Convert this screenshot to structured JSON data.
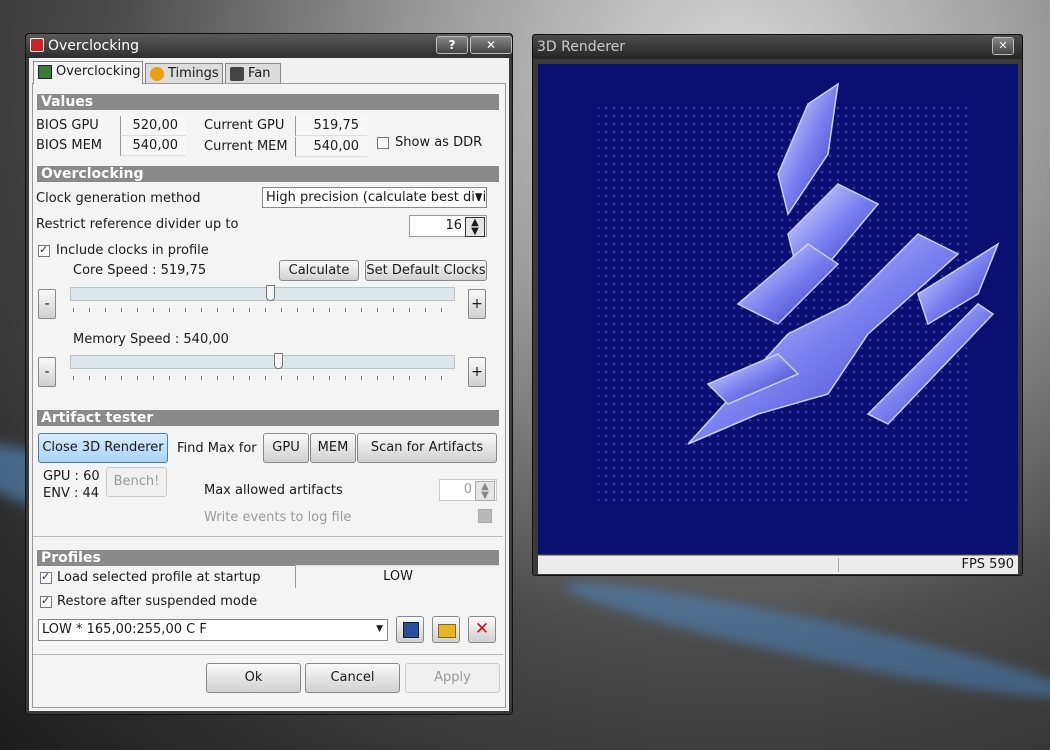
{
  "overclocking_window": {
    "title": "Overclocking",
    "help_label": "?",
    "close_label": "✕",
    "tabs": [
      {
        "label": "Overclocking",
        "icon": "chip-icon"
      },
      {
        "label": "Timings",
        "icon": "timer-icon"
      },
      {
        "label": "Fan",
        "icon": "fan-icon"
      }
    ],
    "values": {
      "header": "Values",
      "bios_gpu_label": "BIOS GPU",
      "bios_gpu_value": "520,00",
      "bios_mem_label": "BIOS MEM",
      "bios_mem_value": "540,00",
      "current_gpu_label": "Current GPU",
      "current_gpu_value": "519,75",
      "current_mem_label": "Current MEM",
      "current_mem_value": "540,00",
      "show_ddr_label": "Show as DDR",
      "show_ddr_checked": false
    },
    "overclocking": {
      "header": "Overclocking",
      "clock_method_label": "Clock generation method",
      "clock_method_value": "High precision (calculate best divi",
      "restrict_label": "Restrict reference divider up to",
      "restrict_value": "16",
      "include_clocks_label": "Include clocks in profile",
      "include_clocks_checked": true,
      "core_speed_label": "Core Speed : 519,75",
      "calculate_label": "Calculate",
      "set_default_label": "Set Default Clocks",
      "memory_speed_label": "Memory Speed : 540,00",
      "minus_label": "-",
      "plus_label": "+",
      "core_slider_level": 0.52,
      "memory_slider_level": 0.54
    },
    "artifact_tester": {
      "header": "Artifact tester",
      "close_renderer_label": "Close 3D Renderer",
      "find_max_label": "Find Max for",
      "gpu_button": "GPU",
      "mem_button": "MEM",
      "scan_button": "Scan for Artifacts",
      "gpu_temp": "GPU : 60",
      "env_temp": "ENV : 44",
      "bench_label": "Bench!",
      "max_artifacts_label": "Max allowed artifacts",
      "max_artifacts_value": "0",
      "write_events_label": "Write events to log file"
    },
    "profiles": {
      "header": "Profiles",
      "load_startup_label": "Load selected profile at startup",
      "load_startup_checked": true,
      "startup_profile": "LOW",
      "restore_label": "Restore after suspended mode",
      "restore_checked": true,
      "profile_selected": "LOW * 165,00:255,00 C  F"
    },
    "buttons": {
      "ok": "Ok",
      "cancel": "Cancel",
      "apply": "Apply"
    }
  },
  "renderer_window": {
    "title": "3D Renderer",
    "close_label": "✕",
    "fps": "FPS 590",
    "background_color": "#0a1072"
  }
}
